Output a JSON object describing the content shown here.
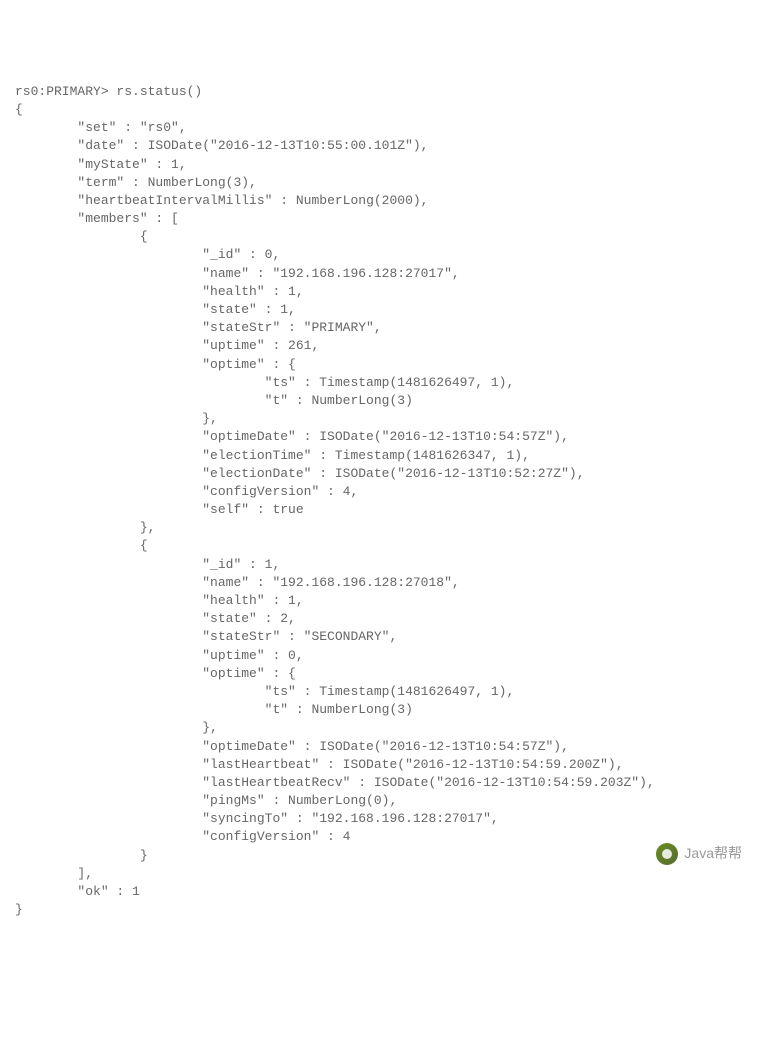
{
  "prompt": "rs0:PRIMARY> rs.status()",
  "open_brace": "{",
  "fields": {
    "set_key": "\"set\" : \"rs0\",",
    "date_key": "\"date\" : ISODate(\"2016-12-13T10:55:00.101Z\"),",
    "myState_key": "\"myState\" : 1,",
    "term_key": "\"term\" : NumberLong(3),",
    "heartbeat_key": "\"heartbeatIntervalMillis\" : NumberLong(2000),",
    "members_key": "\"members\" : [",
    "member_open": "{",
    "m0_id": "\"_id\" : 0,",
    "m0_name": "\"name\" : \"192.168.196.128:27017\",",
    "m0_health": "\"health\" : 1,",
    "m0_state": "\"state\" : 1,",
    "m0_stateStr": "\"stateStr\" : \"PRIMARY\",",
    "m0_uptime": "\"uptime\" : 261,",
    "m0_optime_open": "\"optime\" : {",
    "m0_optime_ts": "\"ts\" : Timestamp(1481626497, 1),",
    "m0_optime_t": "\"t\" : NumberLong(3)",
    "optime_close": "},",
    "m0_optimeDate": "\"optimeDate\" : ISODate(\"2016-12-13T10:54:57Z\"),",
    "m0_electionTime": "\"electionTime\" : Timestamp(1481626347, 1),",
    "m0_electionDate": "\"electionDate\" : ISODate(\"2016-12-13T10:52:27Z\"),",
    "m0_configVersion": "\"configVersion\" : 4,",
    "m0_self": "\"self\" : true",
    "member_close_comma": "},",
    "m1_id": "\"_id\" : 1,",
    "m1_name": "\"name\" : \"192.168.196.128:27018\",",
    "m1_health": "\"health\" : 1,",
    "m1_state": "\"state\" : 2,",
    "m1_stateStr": "\"stateStr\" : \"SECONDARY\",",
    "m1_uptime": "\"uptime\" : 0,",
    "m1_optime_open": "\"optime\" : {",
    "m1_optime_ts": "\"ts\" : Timestamp(1481626497, 1),",
    "m1_optime_t": "\"t\" : NumberLong(3)",
    "m1_optimeDate": "\"optimeDate\" : ISODate(\"2016-12-13T10:54:57Z\"),",
    "m1_lastHeartbeat": "\"lastHeartbeat\" : ISODate(\"2016-12-13T10:54:59.200Z\"),",
    "m1_lastHeartbeatRecv": "\"lastHeartbeatRecv\" : ISODate(\"2016-12-13T10:54:59.203Z\"),",
    "m1_pingMs": "\"pingMs\" : NumberLong(0),",
    "m1_syncingTo": "\"syncingTo\" : \"192.168.196.128:27017\",",
    "m1_configVersion": "\"configVersion\" : 4",
    "member_close": "}",
    "array_close": "],",
    "ok_key": "\"ok\" : 1"
  },
  "close_brace": "}",
  "watermark_text": "Java帮帮"
}
